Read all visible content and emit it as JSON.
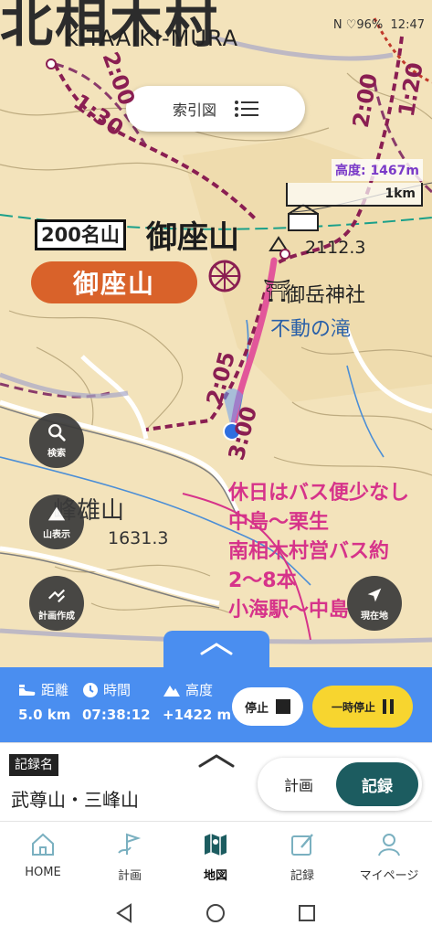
{
  "status_bar": {
    "indicators": "N ♡96%",
    "battery": "96%",
    "time": "12:47"
  },
  "map": {
    "area_title_jp": "北相木村",
    "area_title_en": "KITAAIKI-MURA",
    "index_button": "索引図",
    "altitude_label": "高度: 1467m",
    "scale_label": "1km",
    "label_200": "200名山",
    "mountain_name": "御座山",
    "mountain_badge": "御座山",
    "summit_elevation": "2112.3",
    "shrine": "御岳神社",
    "waterfall": "不動の滝",
    "peak2_name": "峰雄山",
    "peak2_elev": "1631.3",
    "course_times": [
      "2:00",
      "1:30",
      "2:05",
      "3:00",
      "2:00",
      "1:20"
    ],
    "bus_notes": [
      "休日はバス便少なし",
      "中島～栗生",
      "南相木村営バス約",
      "2～8本",
      "小海駅～中島"
    ]
  },
  "fabs": {
    "search": "検索",
    "mountain_display": "山表示",
    "plan_create": "計画作成",
    "current_location": "現在地"
  },
  "stats": {
    "distance_label": "距離",
    "distance_value": "5.0 km",
    "time_label": "時間",
    "time_value": "07:38:12",
    "altitude_label": "高度",
    "altitude_value": "+1422 m"
  },
  "controls": {
    "stop": "停止",
    "pause": "一時停止"
  },
  "record": {
    "tag": "記録名",
    "name": "武尊山・三峰山",
    "tab_plan": "計画",
    "tab_record": "記録"
  },
  "nav": {
    "home": "HOME",
    "plan": "計画",
    "map": "地図",
    "record": "記録",
    "mypage": "マイページ"
  },
  "colors": {
    "accent_blue": "#4a8ef0",
    "pause_yellow": "#f7d52f",
    "record_teal": "#1c5c60",
    "route_pink": "#e2569a"
  }
}
